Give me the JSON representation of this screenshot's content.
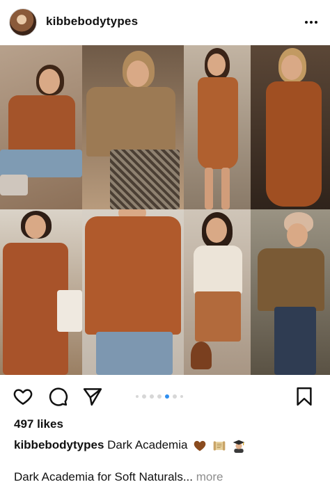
{
  "post": {
    "username": "kibbebodytypes",
    "likes": "497 likes",
    "caption_user": "kibbebodytypes",
    "caption_text": "Dark Academia",
    "caption_emojis": [
      "brown-heart",
      "scroll",
      "woman-student"
    ],
    "subcaption": "Dark Academia for Soft Naturals...",
    "more_label": "more"
  },
  "carousel": {
    "total": 7,
    "active_index": 4
  },
  "colors": {
    "accent": "#2f8ff0",
    "muted": "#8e8e8e"
  },
  "icons": [
    "more-options-icon",
    "heart-icon",
    "comment-icon",
    "share-icon",
    "bookmark-icon"
  ]
}
